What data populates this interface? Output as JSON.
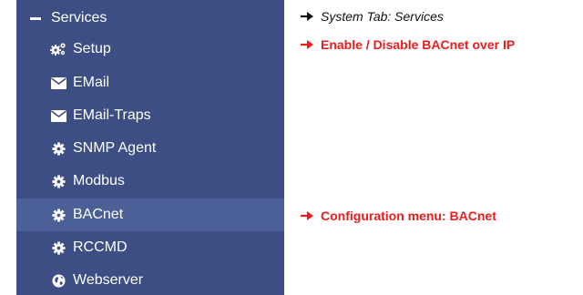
{
  "sidebar": {
    "header": {
      "label": "Services"
    },
    "items": [
      {
        "label": "Setup",
        "icon": "gears-icon"
      },
      {
        "label": "EMail",
        "icon": "envelope-icon"
      },
      {
        "label": "EMail-Traps",
        "icon": "envelope-icon"
      },
      {
        "label": "SNMP Agent",
        "icon": "gear-icon"
      },
      {
        "label": "Modbus",
        "icon": "gear-icon"
      },
      {
        "label": "BACnet",
        "icon": "gear-icon",
        "active": true
      },
      {
        "label": "RCCMD",
        "icon": "gear-icon"
      },
      {
        "label": "Webserver",
        "icon": "globe-icon"
      }
    ]
  },
  "notes": [
    {
      "text": "System Tab: Services",
      "color": "#111111"
    },
    {
      "text": "Enable / Disable BACnet over IP",
      "color": "#ee1c1c"
    },
    {
      "text": "Configuration menu: BACnet",
      "color": "#ee1c1c"
    }
  ],
  "colors": {
    "sidebar_bg": "#3c4e83",
    "active_bg": "#4c6098",
    "accent_red": "#ee1c1c"
  }
}
